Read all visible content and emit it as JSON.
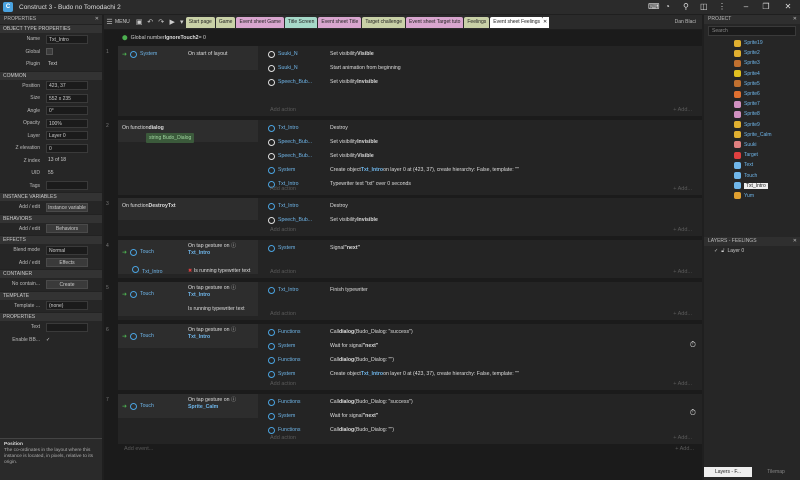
{
  "app": {
    "title": "Construct 3 - Budo no Tomodachi 2",
    "user": "Dan Blaci"
  },
  "toolbar": {
    "menu": "MENU"
  },
  "tabs": [
    {
      "label": "Start page",
      "color": "#c9d1a7"
    },
    {
      "label": "Game",
      "color": "#c9d1a7"
    },
    {
      "label": "Event sheet Game",
      "color": "#d9a6cf"
    },
    {
      "label": "Title Screen",
      "color": "#a6d9c9"
    },
    {
      "label": "Event sheet Title",
      "color": "#d9a6cf"
    },
    {
      "label": "Target challenge",
      "color": "#c9d1a7"
    },
    {
      "label": "Event sheet Target tuto",
      "color": "#d9a6cf"
    },
    {
      "label": "Feelings",
      "color": "#c9d1a7"
    },
    {
      "label": "Event sheet Feelings",
      "color": "#ffffff",
      "active": true
    }
  ],
  "props": {
    "header": "PROPERTIES",
    "sections": {
      "object": "OBJECT TYPE PROPERTIES",
      "common": "COMMON",
      "ivars": "INSTANCE VARIABLES",
      "behaviors": "BEHAVIORS",
      "effects": "EFFECTS",
      "container": "CONTAINER",
      "template": "TEMPLATE",
      "properties": "PROPERTIES"
    },
    "rows": {
      "name": {
        "label": "Name",
        "value": "Txt_Intro"
      },
      "global": {
        "label": "Global"
      },
      "plugin": {
        "label": "Plugin",
        "value": "Text"
      },
      "position": {
        "label": "Position",
        "value": "423, 37"
      },
      "size": {
        "label": "Size",
        "value": "552 x 235"
      },
      "angle": {
        "label": "Angle",
        "value": "0°"
      },
      "opacity": {
        "label": "Opacity",
        "value": "100%"
      },
      "layer": {
        "label": "Layer",
        "value": "Layer 0"
      },
      "zelev": {
        "label": "Z elevation",
        "value": "0"
      },
      "zindex": {
        "label": "Z index",
        "value": "13 of 18"
      },
      "uid": {
        "label": "UID",
        "value": "55"
      },
      "tags": {
        "label": "Tags"
      },
      "ivar": {
        "label": "Add / edit",
        "value": "Instance variable"
      },
      "beh": {
        "label": "Add / edit",
        "value": "Behaviors"
      },
      "blend": {
        "label": "Blend mode",
        "value": "Normal"
      },
      "eff": {
        "label": "Add / edit",
        "value": "Effects"
      },
      "cont": {
        "label": "No contain...",
        "value": "Create"
      },
      "tmpl": {
        "label": "Template ...",
        "value": "(none)"
      },
      "text": {
        "label": "Text"
      },
      "bb": {
        "label": "Enable BB..."
      }
    },
    "info": {
      "title": "Position",
      "body": "The co-ordinates in the layout where this instance is located, in pixels, relative to its origin."
    }
  },
  "sheet": {
    "global": {
      "text": "Global number",
      "name": "IgnoreTouch2",
      "eq": "= 0"
    },
    "add_event": "Add event...",
    "add_action": "Add action",
    "add_more": "+ Add...",
    "e1": {
      "num": "1",
      "cond_obj": "System",
      "cond": "On start of layout",
      "a": [
        [
          "Suuki_N",
          "Set visibility ",
          "Visible",
          ""
        ],
        [
          "Suuki_N",
          "Start animation from beginning",
          "",
          ""
        ],
        [
          "Speech_Bub...",
          "Set visibility ",
          "Invisible",
          ""
        ]
      ]
    },
    "e2": {
      "num": "2",
      "cond": "On function ",
      "fname": "dialog",
      "param": "string Budo_Dialog",
      "a": [
        [
          "Txt_Intro",
          "Destroy",
          "",
          ""
        ],
        [
          "Speech_Bub...",
          "Set visibility ",
          "Invisible",
          ""
        ],
        [
          "Speech_Bub...",
          "Set visibility ",
          "Visible",
          ""
        ],
        [
          "System",
          "Create object ",
          "Txt_Intro",
          " on layer 0 at (423, 37), create hierarchy: False, template: \"\""
        ],
        [
          "Txt_Intro",
          "Typewriter text \"txt\" over 0 seconds",
          "",
          ""
        ]
      ]
    },
    "e3": {
      "num": "3",
      "cond": "On function ",
      "fname": "DestroyTxt",
      "a": [
        [
          "Txt_Intro",
          "Destroy",
          "",
          ""
        ],
        [
          "Speech_Bub...",
          "Set visibility ",
          "Invisible",
          ""
        ]
      ]
    },
    "e4": {
      "num": "4",
      "c1obj": "Touch",
      "c1": "On tap gesture on",
      "c1t": "Txt_Intro",
      "c2obj": "Txt_Intro",
      "c2": "Is running typewriter text",
      "a": [
        [
          "System",
          "Signal ",
          "\"next\"",
          ""
        ]
      ]
    },
    "e5": {
      "num": "5",
      "c1obj": "Touch",
      "c1": "On tap gesture on",
      "c1t": "Txt_Intro",
      "c2": "Is running typewriter text",
      "a": [
        [
          "Txt_Intro",
          "Finish typewriter",
          "",
          ""
        ]
      ]
    },
    "e6": {
      "num": "6",
      "c1obj": "Touch",
      "c1": "On tap gesture on",
      "c1t": "Txt_Intro",
      "a": [
        [
          "Functions",
          "Call ",
          "dialog",
          " (Budo_Dialog: \"success\")"
        ],
        [
          "System",
          "Wait for signal ",
          "\"next\"",
          ""
        ],
        [
          "Functions",
          "Call ",
          "dialog",
          " (Budo_Dialog: \"\")"
        ],
        [
          "System",
          "Create object ",
          "Txt_Intro",
          " on layer 0 at (423, 37), create hierarchy: False, template: \"\""
        ]
      ]
    },
    "e7": {
      "num": "7",
      "c1obj": "Touch",
      "c1": "On tap gesture on",
      "c1t": "Sprite_Calm",
      "a": [
        [
          "Functions",
          "Call ",
          "dialog",
          " (Budo_Dialog: \"success\")"
        ],
        [
          "System",
          "Wait for signal ",
          "\"next\"",
          ""
        ],
        [
          "Functions",
          "Call ",
          "dialog",
          " (Budo_Dialog: \"\")"
        ]
      ]
    }
  },
  "project": {
    "header": "PROJECT",
    "search": "Search",
    "items": [
      {
        "label": "Sprite19",
        "c": "#e0b030"
      },
      {
        "label": "Sprite2",
        "c": "#e0b030"
      },
      {
        "label": "Sprite3",
        "c": "#c07030"
      },
      {
        "label": "Sprite4",
        "c": "#e0c020"
      },
      {
        "label": "Sprite5",
        "c": "#c07030"
      },
      {
        "label": "Sprite6",
        "c": "#e07030"
      },
      {
        "label": "Sprite7",
        "c": "#d090c0"
      },
      {
        "label": "Sprite8",
        "c": "#d090c0"
      },
      {
        "label": "Sprite9",
        "c": "#e0b030"
      },
      {
        "label": "Sprite_Calm",
        "c": "#e0b030"
      },
      {
        "label": "Suuki",
        "c": "#e08080"
      },
      {
        "label": "Target",
        "c": "#e04040"
      },
      {
        "label": "Text",
        "c": "#6fb6ea"
      },
      {
        "label": "Touch",
        "c": "#6fb6ea"
      },
      {
        "label": "Txt_Intro",
        "c": "#6fb6ea",
        "sel": true
      },
      {
        "label": "Yum",
        "c": "#e0a030"
      }
    ]
  },
  "layers": {
    "header": "LAYERS - FEELINGS",
    "items": [
      "Layer 0"
    ],
    "tabs": [
      "Layers - F...",
      "Tilemap"
    ]
  }
}
